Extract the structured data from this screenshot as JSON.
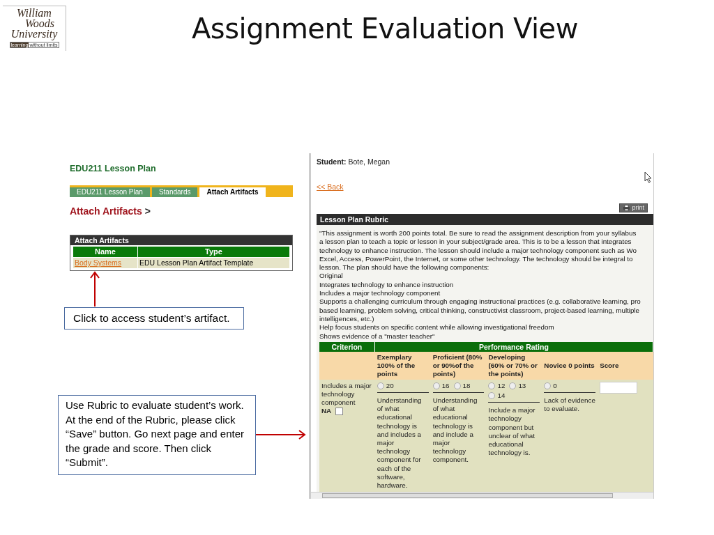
{
  "logo": {
    "name_lines": [
      "William",
      "Woods",
      "University"
    ],
    "tagline_parts": [
      "learning",
      "without limits"
    ]
  },
  "title": "Assignment Evaluation View",
  "course_panel": {
    "heading": "EDU211 Lesson Plan",
    "tabs": [
      {
        "label": "EDU211 Lesson Plan",
        "selected": false
      },
      {
        "label": "Standards",
        "selected": false
      },
      {
        "label": "Attach Artifacts",
        "selected": true
      }
    ],
    "section_title": "Attach Artifacts",
    "section_arrow": ">",
    "table": {
      "caption": "Attach Artifacts",
      "columns": [
        "Name",
        "Type"
      ],
      "rows": [
        {
          "name": "Body Systems",
          "type": "EDU Lesson Plan Artifact Template"
        }
      ]
    }
  },
  "callouts": [
    {
      "text": "Click to access student’s artifact."
    },
    {
      "text": "Use Rubric to evaluate student’s work. At the end of the Rubric, please click “Save” button. Go next page and enter the grade and score. Then click “Submit”."
    }
  ],
  "evaluation": {
    "student_label": "Student:",
    "student_name": "Bote, Megan",
    "back_link": "<< Back",
    "print_button": "print",
    "rubric": {
      "title": "Lesson Plan Rubric",
      "description_lines": [
        "\"This assignment is worth 200 points total. Be sure to read the assignment description from your syllabus",
        "a lesson plan to teach a topic or lesson in your subject/grade area. This is to be a lesson that integrates",
        "technology to enhance instruction. The lesson should include a major technology component such as Wo",
        "Excel, Access, PowerPoint, the Internet, or some other technology. The technology should be integral to",
        "lesson. The plan should have the following components:",
        "Original",
        "Integrates technology to enhance instruction",
        "Includes a major technology component",
        "Supports a challenging curriculum through engaging instructional practices (e.g. collaborative learning, pro",
        "based learning, problem solving, critical thinking, constructivist classroom, project-based learning, multiple",
        "intelligences, etc.)",
        "Help focus students on specific content while allowing investigational freedom",
        "Shows evidence of a \"master teacher\""
      ],
      "header": {
        "criterion": "Criterion",
        "rating": "Performance Rating",
        "score": "Score"
      },
      "levels": [
        "Exemplary 100% of the points",
        "Proficient (80% or 90%of the points)",
        "Developing (60% or 70% or the points)",
        "Novice 0 points"
      ],
      "rows": [
        {
          "criterion": "Includes a major technology component",
          "na_label": "NA",
          "na_checked": false,
          "ratings": [
            {
              "options": [
                {
                  "value": "20",
                  "selected": false
                }
              ],
              "description": "Understanding of what educational technology is and includes a major technology component for each of the software, hardware."
            },
            {
              "options": [
                {
                  "value": "16",
                  "selected": false
                },
                {
                  "value": "18",
                  "selected": false
                }
              ],
              "description": "Understanding of what educational technology is and include a major technology component."
            },
            {
              "options": [
                {
                  "value": "12",
                  "selected": false
                },
                {
                  "value": "13",
                  "selected": false
                },
                {
                  "value": "14",
                  "selected": false
                }
              ],
              "description": "Include a major technology component but unclear of what educational technology is."
            },
            {
              "options": [
                {
                  "value": "0",
                  "selected": false
                }
              ],
              "description": "Lack of evidence to evaluate."
            }
          ]
        }
      ]
    }
  }
}
